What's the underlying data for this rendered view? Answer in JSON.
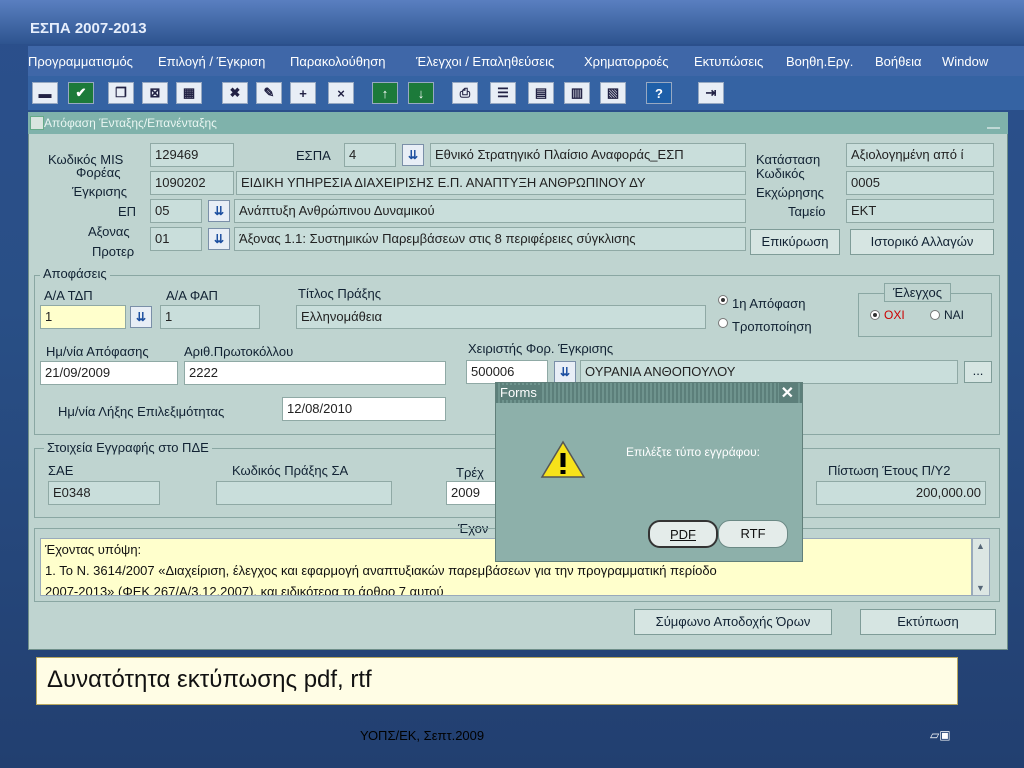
{
  "app": {
    "title": "ΕΣΠΑ 2007-2013"
  },
  "menu": [
    "Προγραμματισμός",
    "Επιλογή / Έγκριση",
    "Παρακολούθηση",
    "Έλεγχοι / Επαληθεύσεις",
    "Χρηματορροές",
    "Εκτυπώσεις",
    "Βοηθη.Εργ.",
    "Βοήθεια",
    "Window"
  ],
  "window": {
    "title": "Απόφαση Ένταξης/Επανένταξης"
  },
  "header": {
    "mis_label": "Κωδικός MIS",
    "mis_value": "129469",
    "espa_label": "ΕΣΠΑ",
    "espa_value": "4",
    "espa_desc": "Εθνικό Στρατηγικό Πλαίσιο Αναφοράς_ΕΣΠ",
    "forea_label_1": "Φορέας",
    "forea_label_2": "Έγκρισης",
    "forea_value": "1090202",
    "forea_desc": "ΕΙΔΙΚΗ ΥΠΗΡΕΣΙΑ ΔΙΑΧΕΙΡΙΣΗΣ Ε.Π. ΑΝΑΠΤΥΞΗ ΑΝΘΡΩΠΙΝΟΥ ΔΥ",
    "ep_label": "ΕΠ",
    "ep_value": "05",
    "ep_desc": "Ανάπτυξη Ανθρώπινου Δυναμικού",
    "axonas_label_1": "Αξονας",
    "axonas_label_2": "Προτερ",
    "axonas_value": "01",
    "axonas_desc": "Άξονας 1.1: Συστημικών Παρεμβάσεων στις 8 περιφέρειες σύγκλισης",
    "status_label": "Κατάσταση",
    "status_value": "Αξιολογημένη από ί",
    "code_label_1": "Κωδικός",
    "code_label_2": "Εκχώρησης",
    "code_value": "0005",
    "tameio_label": "Ταμείο",
    "tameio_value": "ΕΚΤ",
    "confirm_button": "Επικύρωση",
    "history_button": "Ιστορικό Αλλαγών"
  },
  "decisions": {
    "group_title": "Αποφάσεις",
    "aa_tdp_label": "Α/Α ΤΔΠ",
    "aa_tdp_value": "1",
    "aa_fap_label": "Α/Α ΦΑΠ",
    "aa_fap_value": "1",
    "title_label": "Τίτλος Πράξης",
    "title_value": "Ελληνομάθεια",
    "radio_first": "1η Απόφαση",
    "radio_modify": "Τροποποίηση",
    "check_group": "Έλεγχος",
    "check_no": "ΟΧΙ",
    "check_yes": "ΝΑΙ",
    "date_label": "Ημ/νία Απόφασης",
    "date_value": "21/09/2009",
    "protocol_label": "Αριθ.Πρωτοκόλλου",
    "protocol_value": "2222",
    "handler_label": "Χειριστής Φορ. Έγκρισης",
    "handler_code": "500006",
    "handler_name": "ΟΥΡΑΝΙΑ ΑΝΘΟΠΟΥΛΟΥ",
    "handler_more": "...",
    "eligibility_label": "Ημ/νία Λήξης Επιλεξιμότητας",
    "eligibility_value": "12/08/2010"
  },
  "pde": {
    "group_title": "Στοιχεία Εγγραφής στο ΠΔΕ",
    "sae_label": "ΣΑΕ",
    "sae_value": "E0348",
    "code_label": "Κωδικός Πράξης ΣΑ",
    "code_value": "",
    "current_label": "Τρέχ",
    "current_value": "2009",
    "credit_label": "Πίστωση Έτους Π/Υ2",
    "credit_value": "200,000.00"
  },
  "considering": {
    "label": "Έχον",
    "lines": [
      "Έχοντας υπόψη:",
      "1.    Το Ν. 3614/2007 «Διαχείριση, έλεγχος και εφαρμογή αναπτυξιακών παρεμβάσεων για την προγραμματική περίοδο",
      "2007-2013» (ΦΕΚ 267/Α/3.12.2007), και ειδικότερα το άρθρο 7 αυτού"
    ]
  },
  "bottom_buttons": {
    "agreement": "Σύμφωνο Αποδοχής Όρων",
    "print": "Εκτύπωση"
  },
  "dialog": {
    "title": "Forms",
    "close": "✕",
    "message": "Επιλέξτε τύπο εγγράφου:",
    "pdf": "PDF",
    "rtf": "RTF"
  },
  "caption": "Δυνατότητα εκτύπωσης pdf, rtf",
  "footer": "ΥΟΠΣ/ΕΚ, Σεπτ.2009",
  "colors": {
    "accent": "#2b4f8c",
    "form_bg": "#bfd4d0",
    "dialog_bg": "#8db0aa"
  }
}
